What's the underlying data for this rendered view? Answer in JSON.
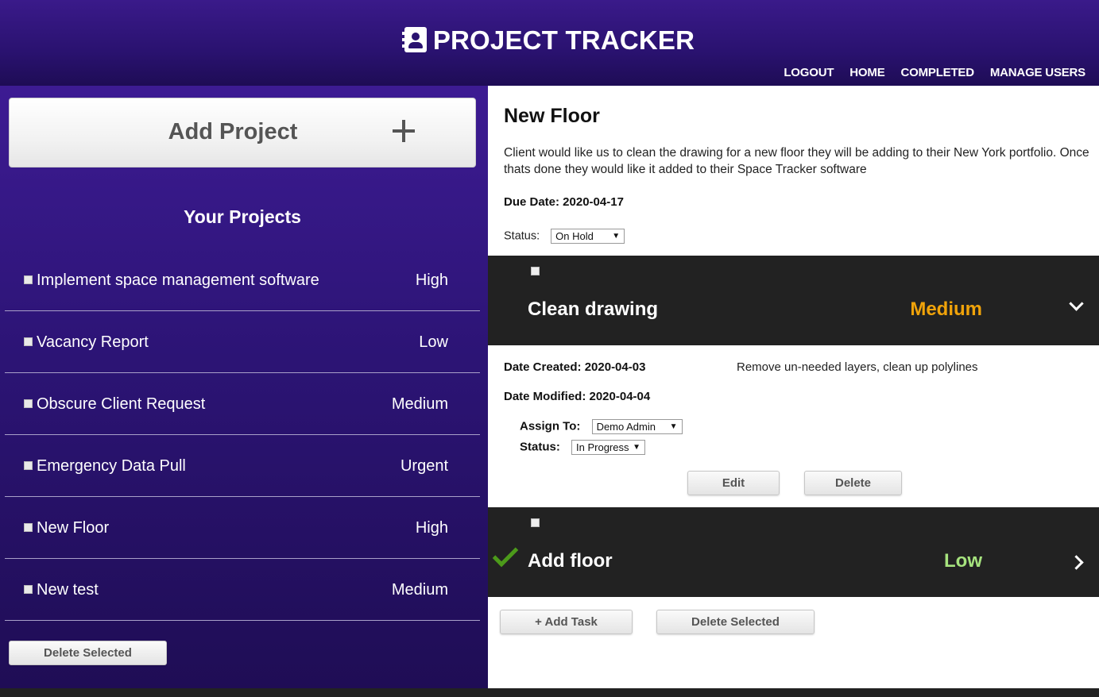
{
  "header": {
    "title": "PROJECT TRACKER",
    "icon": "contact-book-icon",
    "nav": [
      "LOGOUT",
      "HOME",
      "COMPLETED",
      "MANAGE USERS"
    ]
  },
  "sidebar": {
    "add_project_label": "Add Project",
    "add_icon": "plus-icon",
    "section_title": "Your Projects",
    "projects": [
      {
        "name": "Implement space management software",
        "priority": "High"
      },
      {
        "name": "Vacancy Report",
        "priority": "Low"
      },
      {
        "name": "Obscure Client Request",
        "priority": "Medium"
      },
      {
        "name": "Emergency Data Pull",
        "priority": "Urgent"
      },
      {
        "name": "New Floor",
        "priority": "High"
      },
      {
        "name": "New test",
        "priority": "Medium"
      }
    ],
    "delete_selected_label": "Delete Selected"
  },
  "project": {
    "title": "New Floor",
    "description": "Client would like us to clean the drawing for a new floor they will be adding to their New York portfolio. Once thats done they would like it added to their Space Tracker software",
    "due_date": "Due Date: 2020-04-17",
    "status_label": "Status:",
    "status_value": "On Hold"
  },
  "tasks": [
    {
      "name": "Clean drawing",
      "priority": "Medium",
      "priority_color": "#f0a30a",
      "expanded": true,
      "completed": false,
      "date_created": "Date Created: 2020-04-03",
      "date_modified": "Date Modified: 2020-04-04",
      "description": "Remove un-needed layers, clean up polylines",
      "assign_label": "Assign To:",
      "assign_value": "Demo Admin",
      "status_label": "Status:",
      "status_value": "In Progress",
      "edit_label": "Edit",
      "delete_label": "Delete"
    },
    {
      "name": "Add floor",
      "priority": "Low",
      "priority_color": "#a6e37e",
      "expanded": false,
      "completed": true
    }
  ],
  "actions": {
    "add_task_label": "+ Add Task",
    "delete_selected_label": "Delete Selected"
  },
  "colors": {
    "header_purple": "#2a1270",
    "sidebar_purple": "#2c1475",
    "task_header_bg": "#222222",
    "check_green": "#4c9a1a"
  }
}
